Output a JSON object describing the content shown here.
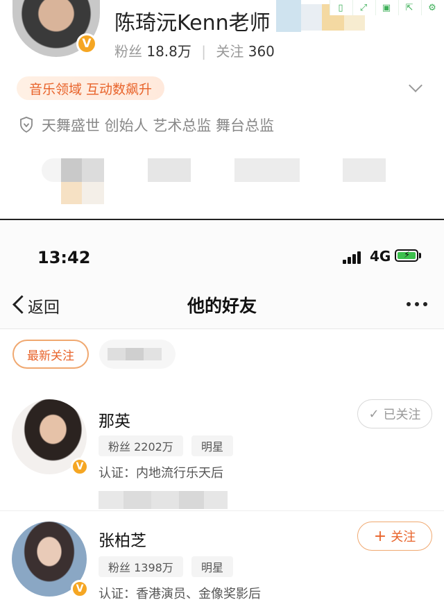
{
  "profile": {
    "name": "陈琦沅Kenn老师",
    "fans_label": "粉丝",
    "fans_value": "18.8万",
    "following_label": "关注",
    "following_value": "360",
    "tag": "音乐领域 互动数飙升",
    "description": "天舞盛世 创始人 艺术总监 舞台总监",
    "verified_badge": "V"
  },
  "status_bar": {
    "time": "13:42",
    "network": "4G"
  },
  "nav": {
    "back_label": "返回",
    "title": "他的好友"
  },
  "filter": {
    "active_label": "最新关注"
  },
  "friends": [
    {
      "name": "那英",
      "fans": "粉丝 2202万",
      "category": "明星",
      "verification": "认证：内地流行乐天后",
      "follow_label": "已关注",
      "follow_icon": "✓",
      "followed": true,
      "badge": "V"
    },
    {
      "name": "张柏芝",
      "fans": "粉丝 1398万",
      "category": "明星",
      "verification": "认证：香港演员、金像奖影后",
      "follow_label": "关注",
      "follow_icon": "+",
      "followed": false,
      "badge": "V"
    }
  ],
  "colors": {
    "accent": "#e8632a",
    "badge": "#f5a623",
    "battery": "#3cc04d",
    "toolbar_icons": "#3fb05a"
  }
}
